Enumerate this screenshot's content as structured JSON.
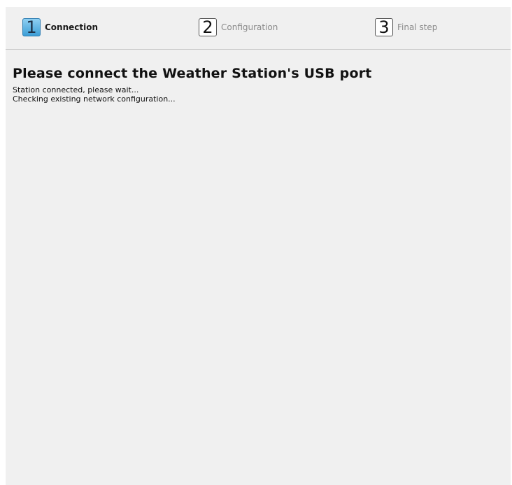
{
  "steps": [
    {
      "number": "1",
      "label": "Connection",
      "state": "active"
    },
    {
      "number": "2",
      "label": "Configuration",
      "state": "inactive"
    },
    {
      "number": "3",
      "label": "Final step",
      "state": "inactive"
    }
  ],
  "main": {
    "title": "Please connect the Weather Station's USB port",
    "status_lines": [
      "Station connected, please wait...",
      "Checking existing network configuration..."
    ]
  },
  "colors": {
    "active_step": "#3c9ed6",
    "background": "#f0f0f0"
  }
}
